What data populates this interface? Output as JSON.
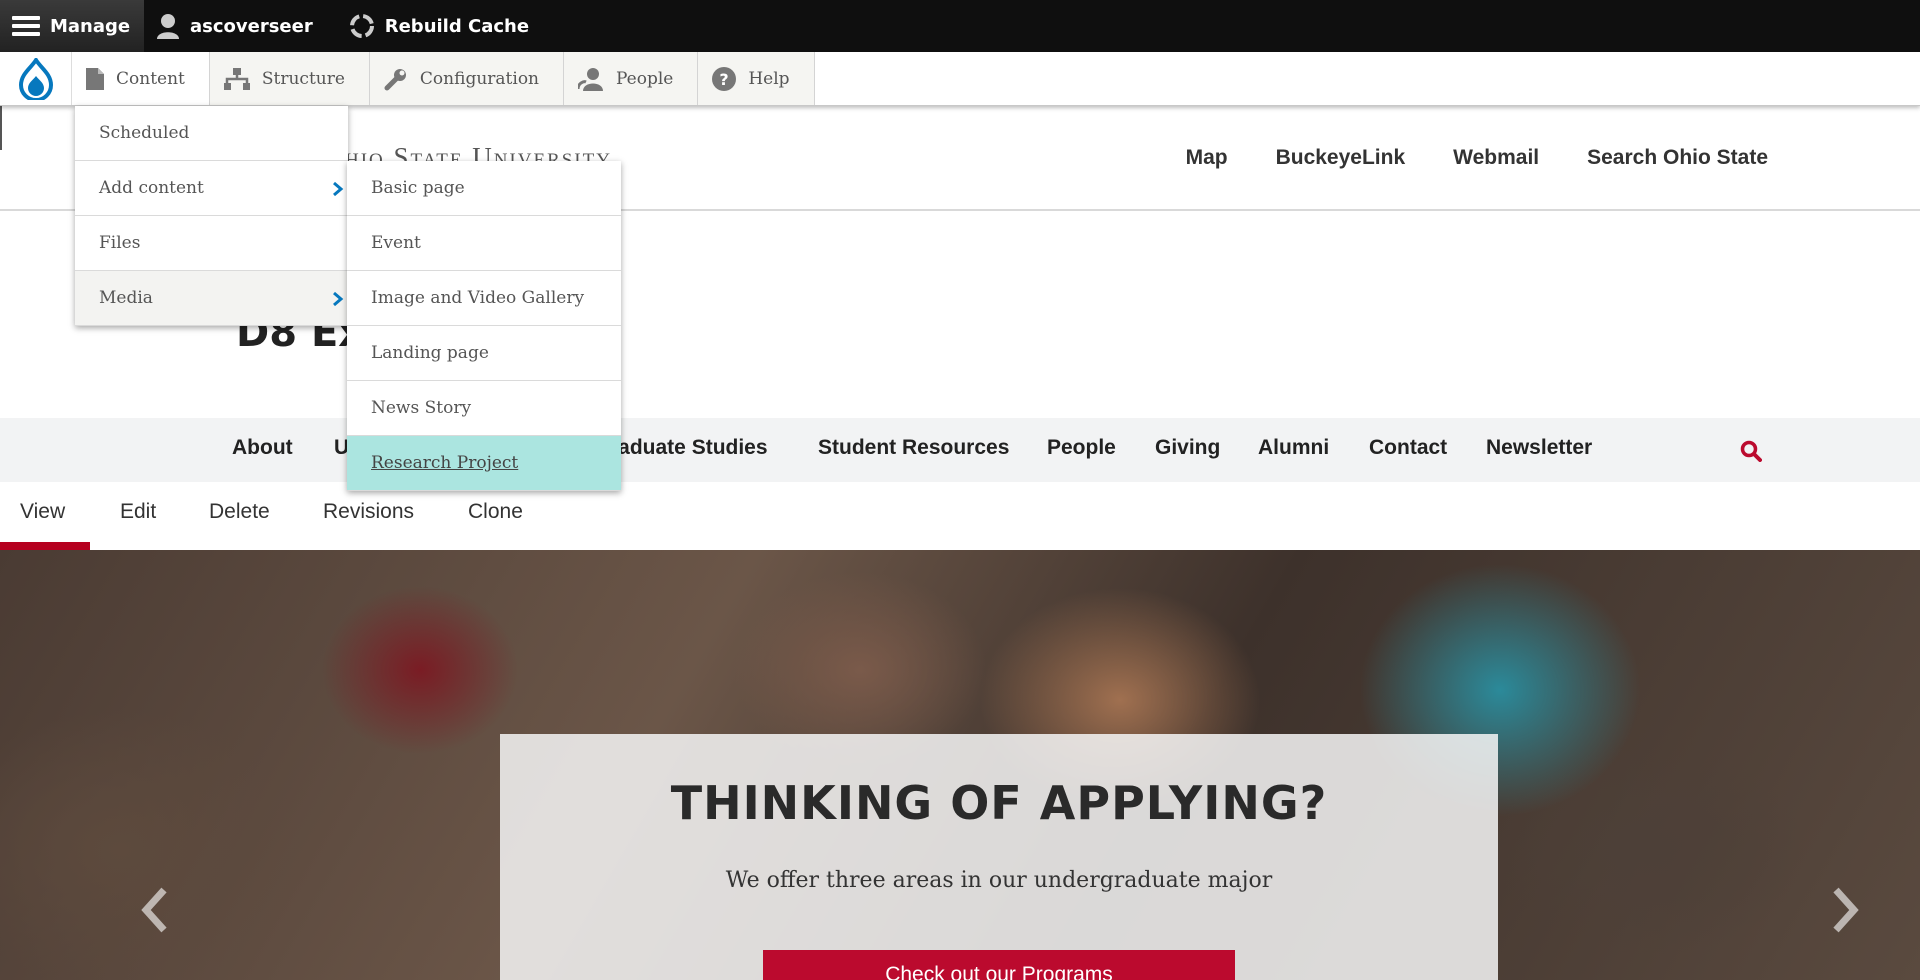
{
  "admin_bar": {
    "manage_label": "Manage",
    "user_label": "ascoverseer",
    "rebuild_label": "Rebuild Cache"
  },
  "toolbar": {
    "items": [
      {
        "label": "Content",
        "icon": "page-icon"
      },
      {
        "label": "Structure",
        "icon": "sitemap-icon"
      },
      {
        "label": "Configuration",
        "icon": "wrench-icon"
      },
      {
        "label": "People",
        "icon": "person-icon"
      },
      {
        "label": "Help",
        "icon": "help-icon"
      }
    ]
  },
  "content_menu": {
    "items": [
      "Scheduled",
      "Add content",
      "Files",
      "Media"
    ]
  },
  "add_content_menu": {
    "items": [
      "Basic page",
      "Event",
      "Image and Video Gallery",
      "Landing page",
      "News Story",
      "Research Project"
    ]
  },
  "site_header": {
    "university_name": "hio State University",
    "utility_links": [
      "Map",
      "BuckeyeLink",
      "Webmail",
      "Search Ohio State"
    ]
  },
  "site_title": "D8 Ex",
  "main_nav": {
    "items": [
      "About",
      "U",
      "raduate Studies",
      "Student Resources",
      "People",
      "Giving",
      "Alumni",
      "Contact",
      "Newsletter"
    ]
  },
  "local_tabs": {
    "items": [
      "View",
      "Edit",
      "Delete",
      "Revisions",
      "Clone"
    ]
  },
  "hero": {
    "title": "THINKING OF APPLYING?",
    "subtitle": "We offer three areas in our undergraduate major",
    "button_label": "Check out our Programs"
  },
  "colors": {
    "admin_bar": "#0f0f0f",
    "accent_red": "#bb0a2e",
    "highlight": "#abe5e0",
    "drupal_blue": "#0678be"
  }
}
